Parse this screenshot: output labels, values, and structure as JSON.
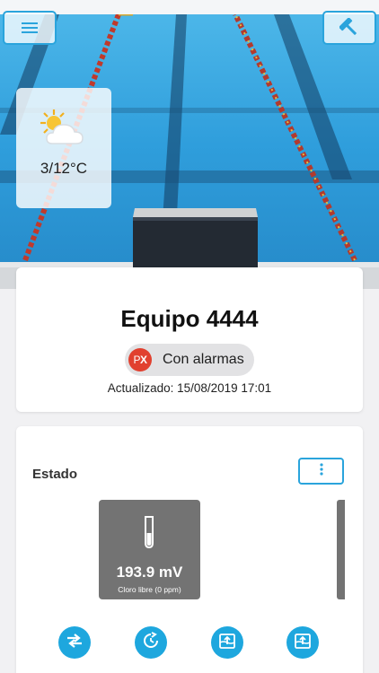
{
  "header": {
    "menu_icon": "hamburger-menu-icon",
    "tools_icon": "hammer-icon"
  },
  "weather": {
    "icon": "partly-sunny-cloud-icon",
    "temperature": "3/12°C"
  },
  "device": {
    "title": "Equipo 4444",
    "badge_icon_text": "PX",
    "badge_label": "Con alarmas",
    "updated": "Actualizado: 15/08/2019 17:01"
  },
  "status": {
    "heading": "Estado",
    "more_icon": "vertical-dots-icon",
    "sensor": {
      "icon": "test-tube-icon",
      "value": "193.9 mV",
      "caption": "Cloro libre (0 ppm)"
    }
  },
  "actions": [
    {
      "icon": "swap-arrows-icon"
    },
    {
      "icon": "timer-refresh-icon"
    },
    {
      "icon": "pool-upload-icon"
    },
    {
      "icon": "pool-upload-icon"
    }
  ],
  "colors": {
    "accent": "#2aa4dc",
    "action_fill": "#1ea7de",
    "alarm_red": "#e1402f",
    "sensor_gray": "#737373",
    "pool_blue": "#2a9fdc"
  }
}
